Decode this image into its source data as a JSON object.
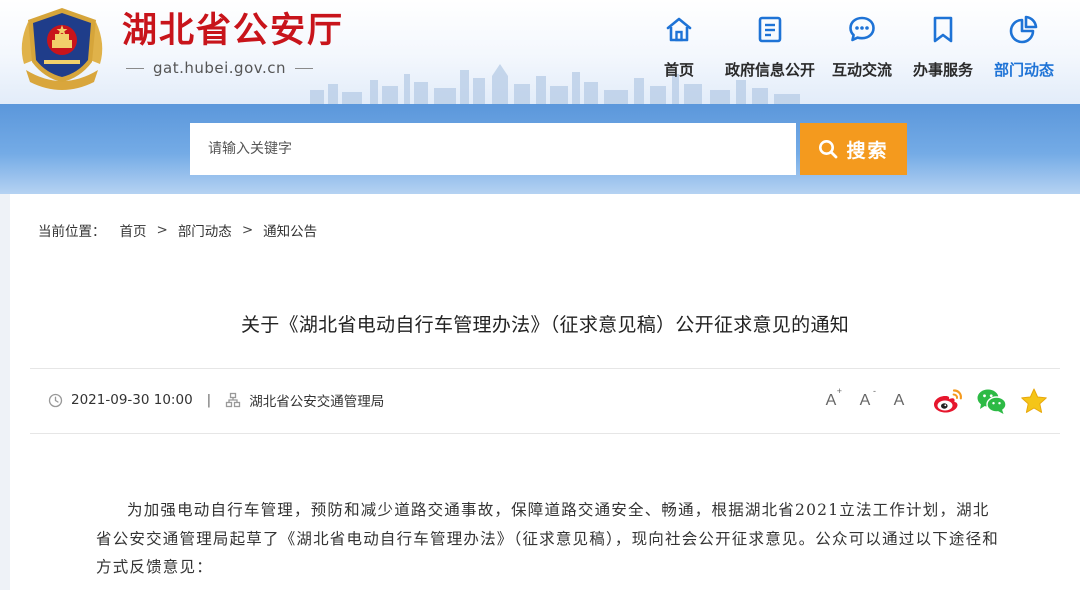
{
  "header": {
    "site_title": "湖北省公安厅",
    "site_domain": "gat.hubei.gov.cn"
  },
  "nav": {
    "items": [
      {
        "label": "首页",
        "icon": "home-icon",
        "active": false
      },
      {
        "label": "政府信息公开",
        "icon": "document-icon",
        "active": false
      },
      {
        "label": "互动交流",
        "icon": "chat-bubble-icon",
        "active": false
      },
      {
        "label": "办事服务",
        "icon": "bookmark-icon",
        "active": false
      },
      {
        "label": "部门动态",
        "icon": "pie-chart-icon",
        "active": true
      }
    ]
  },
  "search": {
    "placeholder": "请输入关键字",
    "button_label": "搜索"
  },
  "breadcrumb": {
    "label": "当前位置：",
    "items": [
      "首页",
      "部门动态",
      "通知公告"
    ],
    "separator": ">"
  },
  "article": {
    "title": "关于《湖北省电动自行车管理办法》（征求意见稿）公开征求意见的通知",
    "datetime": "2021-09-30 10:00",
    "meta_separator": "|",
    "source": "湖北省公安交通管理局",
    "body": "为加强电动自行车管理，预防和减少道路交通事故，保障道路交通安全、畅通，根据湖北省2021立法工作计划，湖北省公安交通管理局起草了《湖北省电动自行车管理办法》（征求意见稿），现向社会公开征求意见。公众可以通过以下途径和方式反馈意见："
  },
  "tools": {
    "font_size_buttons": [
      {
        "label": "A",
        "modifier": "+"
      },
      {
        "label": "A",
        "modifier": "-"
      },
      {
        "label": "A",
        "modifier": ""
      }
    ],
    "share": [
      "weibo-icon",
      "wechat-icon",
      "favorite-star-icon"
    ]
  },
  "colors": {
    "brand_red": "#c8141b",
    "nav_active": "#1e73d6",
    "search_button": "#f49a1e",
    "search_band": "#6aa4e2"
  }
}
